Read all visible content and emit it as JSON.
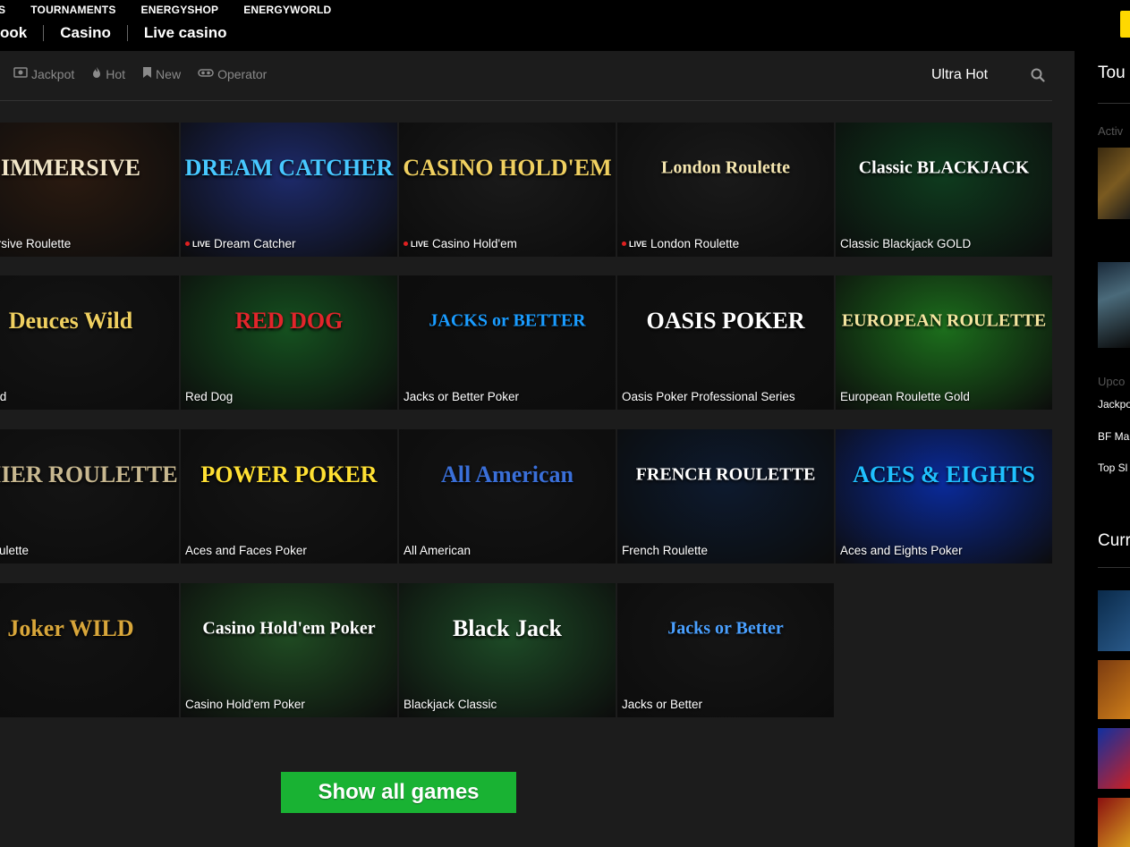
{
  "topnav": {
    "row1": [
      "S",
      "TOURNAMENTS",
      "ENERGYSHOP",
      "ENERGYWORLD"
    ],
    "row2": [
      "ook",
      "Casino",
      "Live casino"
    ]
  },
  "filters": [
    {
      "icon": "jackpot-icon",
      "label": "Jackpot"
    },
    {
      "icon": "flame-icon",
      "label": "Hot"
    },
    {
      "icon": "bookmark-icon",
      "label": "New"
    },
    {
      "icon": "operator-icon",
      "label": "Operator"
    }
  ],
  "selected_filter": "Ultra Hot",
  "live_label": "LIVE",
  "games": [
    {
      "name": "Immersive Roulette",
      "caption": "Immersive Roulette",
      "live": false,
      "logo": "IMMERSIVE",
      "bg": "#2a1a10"
    },
    {
      "name": "Dream Catcher",
      "caption": "Dream Catcher",
      "live": true,
      "logo": "DREAM CATCHER",
      "bg": "#1d2a6a"
    },
    {
      "name": "Casino Hold'em",
      "caption": "Casino Hold'em",
      "live": true,
      "logo": "CASINO HOLD'EM",
      "bg": "#1a1a1a"
    },
    {
      "name": "London Roulette",
      "caption": "London Roulette",
      "live": true,
      "logo": "London Roulette",
      "bg": "#1a1a1a"
    },
    {
      "name": "Classic Blackjack GOLD",
      "caption": "Classic Blackjack GOLD",
      "live": false,
      "logo": "Classic BLACKJACK",
      "bg": "#0e3b1e"
    },
    {
      "name": "Deuces Wild",
      "caption": "es Wild",
      "live": false,
      "logo": "Deuces Wild",
      "bg": "#141414"
    },
    {
      "name": "Red Dog",
      "caption": "Red Dog",
      "live": false,
      "logo": "RED DOG",
      "bg": "#15501f"
    },
    {
      "name": "Jacks or Better Poker",
      "caption": "Jacks or Better Poker",
      "live": false,
      "logo": "JACKS or BETTER",
      "bg": "#101010"
    },
    {
      "name": "Oasis Poker Professional Series",
      "caption": "Oasis Poker Professional Series",
      "live": false,
      "logo": "OASIS POKER",
      "bg": "#111111"
    },
    {
      "name": "European Roulette Gold",
      "caption": "European Roulette Gold",
      "live": false,
      "logo": "EUROPEAN ROULETTE",
      "bg": "#1c6e1c"
    },
    {
      "name": "Premier Roulette",
      "caption": "ier Roulette",
      "live": false,
      "logo": "EMIER ROULETTE",
      "bg": "#141414"
    },
    {
      "name": "Aces and Faces Poker",
      "caption": "Aces and Faces Poker",
      "live": false,
      "logo": "POWER POKER",
      "bg": "#151515"
    },
    {
      "name": "All American",
      "caption": "All American",
      "live": false,
      "logo": "All American",
      "bg": "#141414"
    },
    {
      "name": "French Roulette",
      "caption": "French Roulette",
      "live": false,
      "logo": "FRENCH ROULETTE",
      "bg": "#0d1a2e"
    },
    {
      "name": "Aces and Eights Poker",
      "caption": "Aces and Eights Poker",
      "live": false,
      "logo": "ACES & EIGHTS",
      "bg": "#0a2a9a"
    },
    {
      "name": "Joker Wild",
      "caption": "Wild",
      "live": false,
      "logo": "Joker WILD",
      "bg": "#121212"
    },
    {
      "name": "Casino Hold'em Poker",
      "caption": "Casino Hold'em Poker",
      "live": false,
      "logo": "Casino Hold'em Poker",
      "bg": "#1f4a22"
    },
    {
      "name": "Blackjack Classic",
      "caption": "Blackjack Classic",
      "live": false,
      "logo": "Black Jack",
      "bg": "#1d4a26"
    },
    {
      "name": "Jacks or Better",
      "caption": "Jacks or Better",
      "live": false,
      "logo": "Jacks or Better",
      "bg": "#151515"
    }
  ],
  "show_all_label": "Show all games",
  "sidebar": {
    "title": "Tou",
    "active_label": "Activ",
    "upcoming_label": "Upco",
    "upcoming_items": [
      "Jackpo",
      "BF Ma",
      "Top Sl"
    ],
    "current_title": "Curr"
  },
  "colors": {
    "accent_green": "#19b233",
    "accent_yellow": "#ffd800",
    "live_red": "#e02020"
  }
}
